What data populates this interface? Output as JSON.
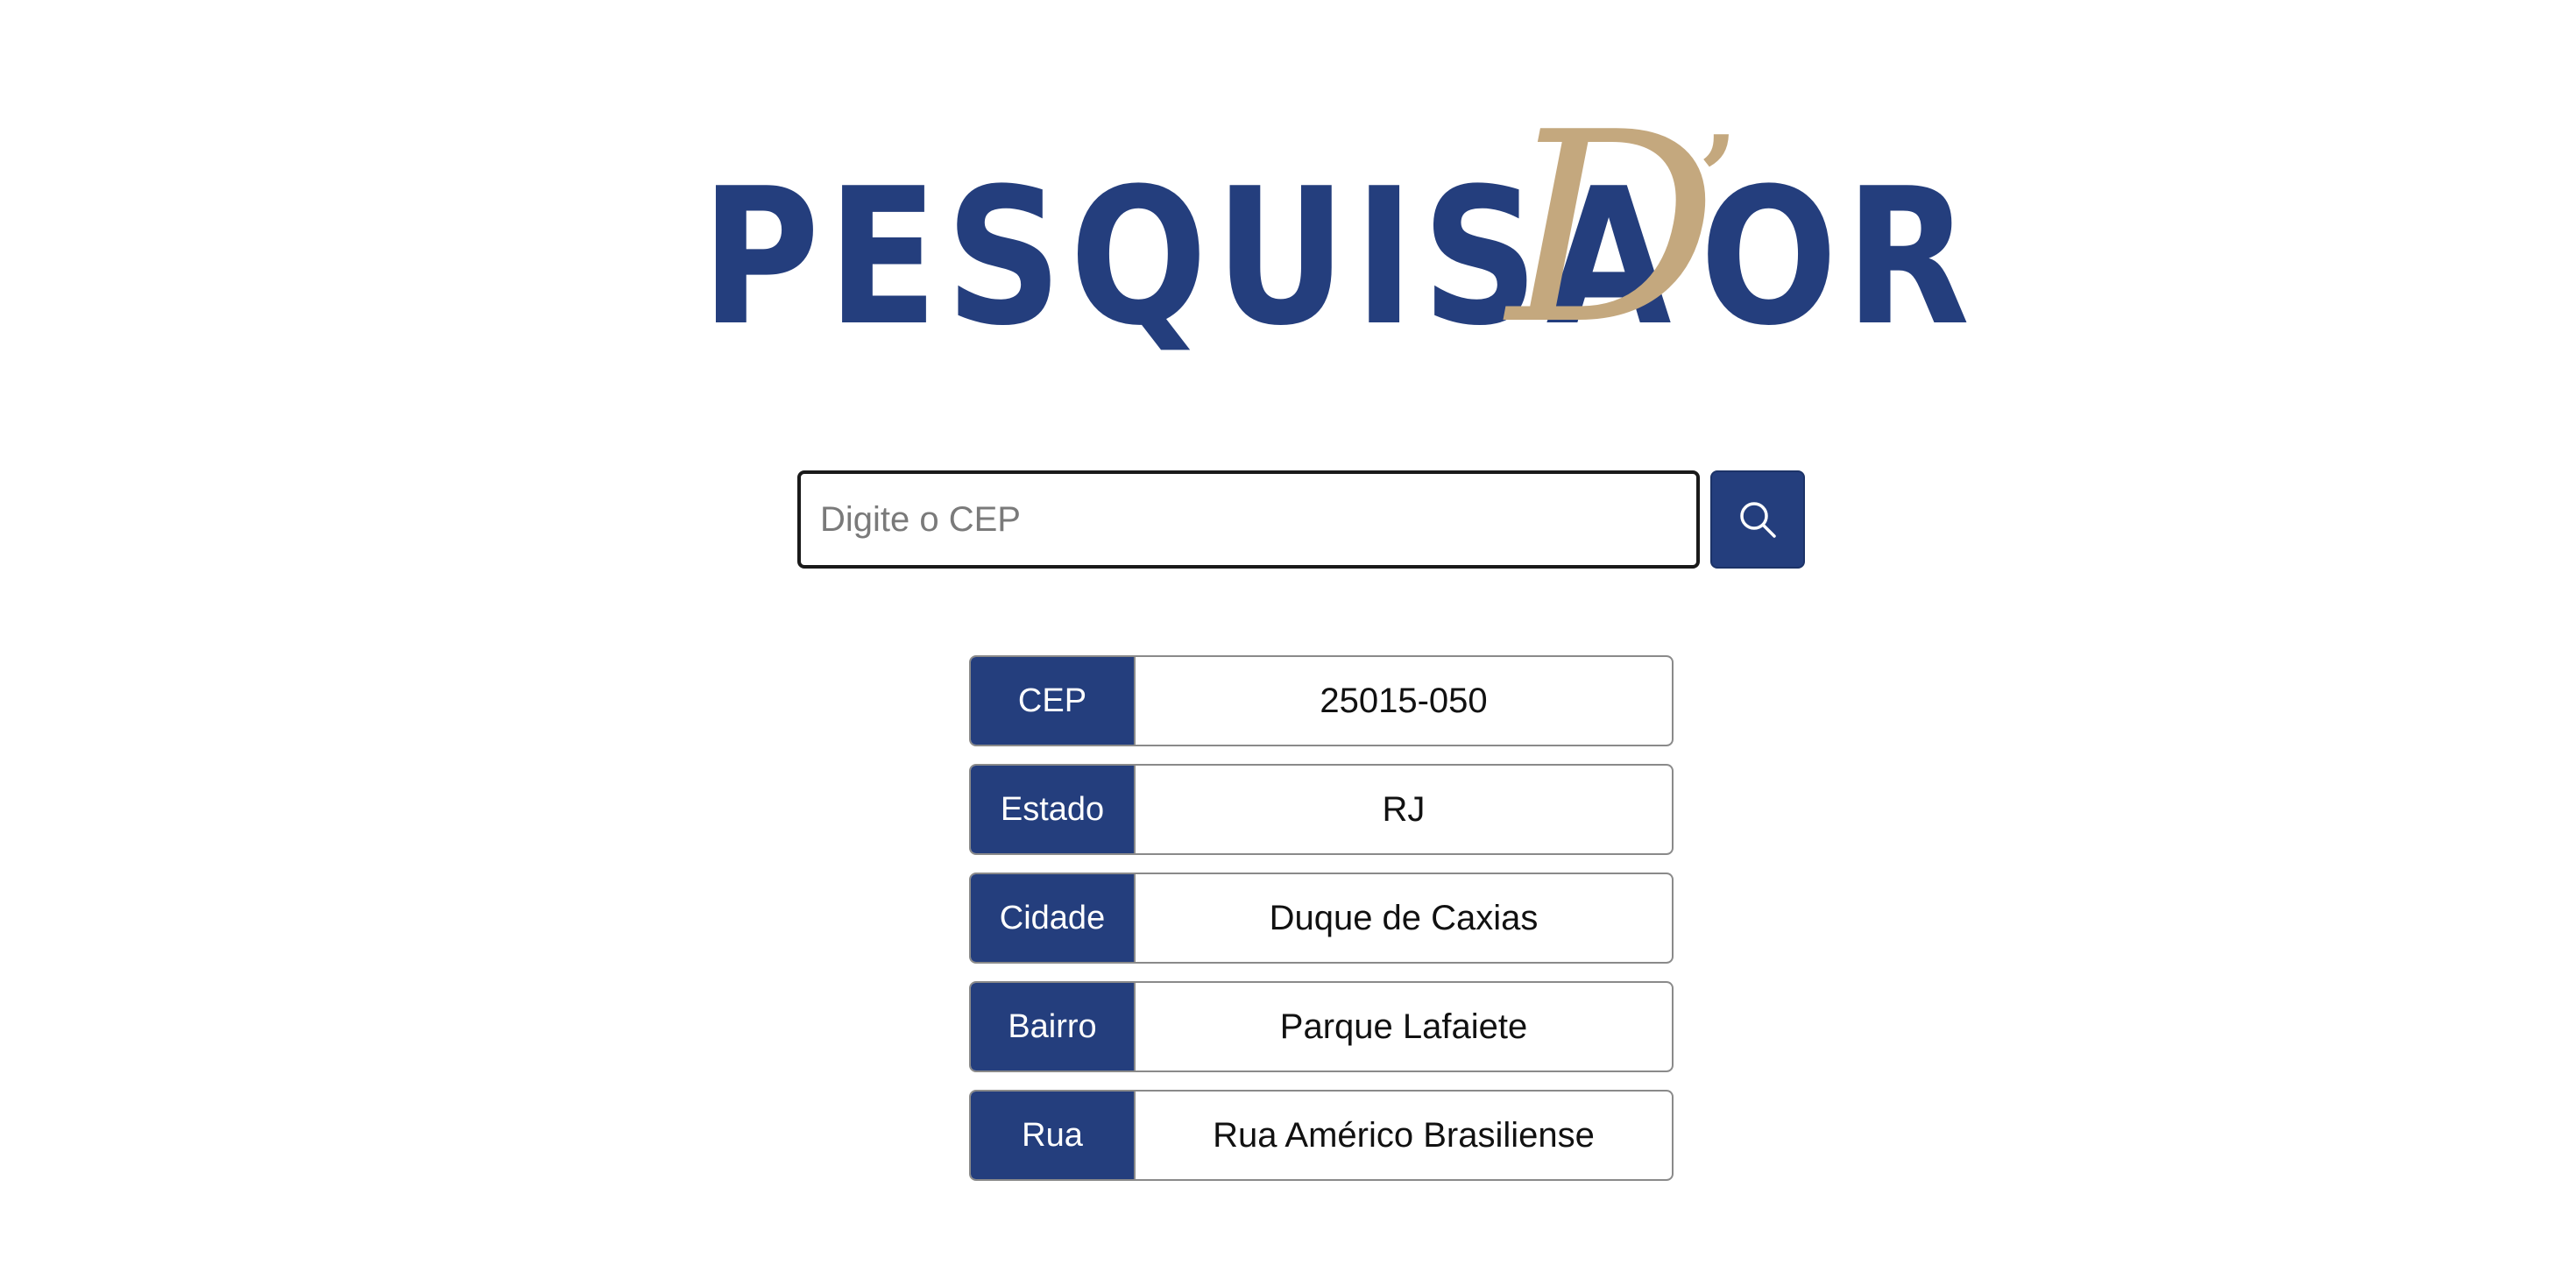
{
  "brand": {
    "word": "PESQUISA",
    "script_letter": "D",
    "apostrophe": "’",
    "suffix": "OR",
    "colors": {
      "navy": "#243e7d",
      "gold": "#c4a87e"
    }
  },
  "search": {
    "placeholder": "Digite o CEP",
    "value": "",
    "button_icon": "search-icon"
  },
  "results": [
    {
      "label": "CEP",
      "value": "25015-050"
    },
    {
      "label": "Estado",
      "value": "RJ"
    },
    {
      "label": "Cidade",
      "value": "Duque de Caxias"
    },
    {
      "label": "Bairro",
      "value": "Parque Lafaiete"
    },
    {
      "label": "Rua",
      "value": "Rua Américo Brasiliense"
    }
  ]
}
